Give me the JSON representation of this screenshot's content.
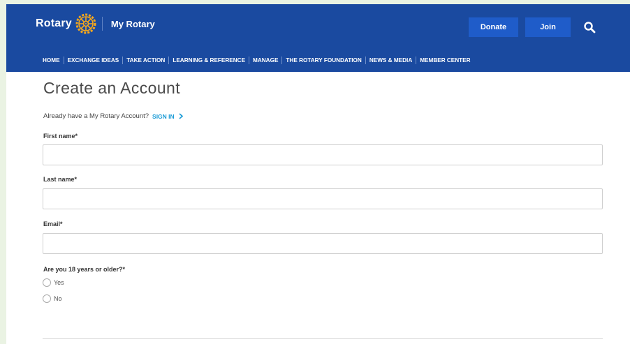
{
  "header": {
    "brand_name": "Rotary",
    "brand_sub": "My Rotary",
    "donate_label": "Donate",
    "join_label": "Join",
    "search_icon": "search-icon",
    "brand_color": "#1a4aa0",
    "wheel_color": "#f7a81b"
  },
  "nav": {
    "items": [
      "HOME",
      "EXCHANGE IDEAS",
      "TAKE ACTION",
      "LEARNING & REFERENCE",
      "MANAGE",
      "THE ROTARY FOUNDATION",
      "NEWS & MEDIA",
      "MEMBER CENTER"
    ]
  },
  "main": {
    "title": "Create an Account",
    "already_text": "Already have a My Rotary Account?",
    "signin_label": "SIGN IN",
    "link_color": "#1a9bd6"
  },
  "form": {
    "first_name_label": "First name*",
    "first_name_value": "",
    "last_name_label": "Last name*",
    "last_name_value": "",
    "email_label": "Email*",
    "email_value": "",
    "age_question": "Are you 18 years or older?*",
    "options": [
      "Yes",
      "No"
    ]
  }
}
